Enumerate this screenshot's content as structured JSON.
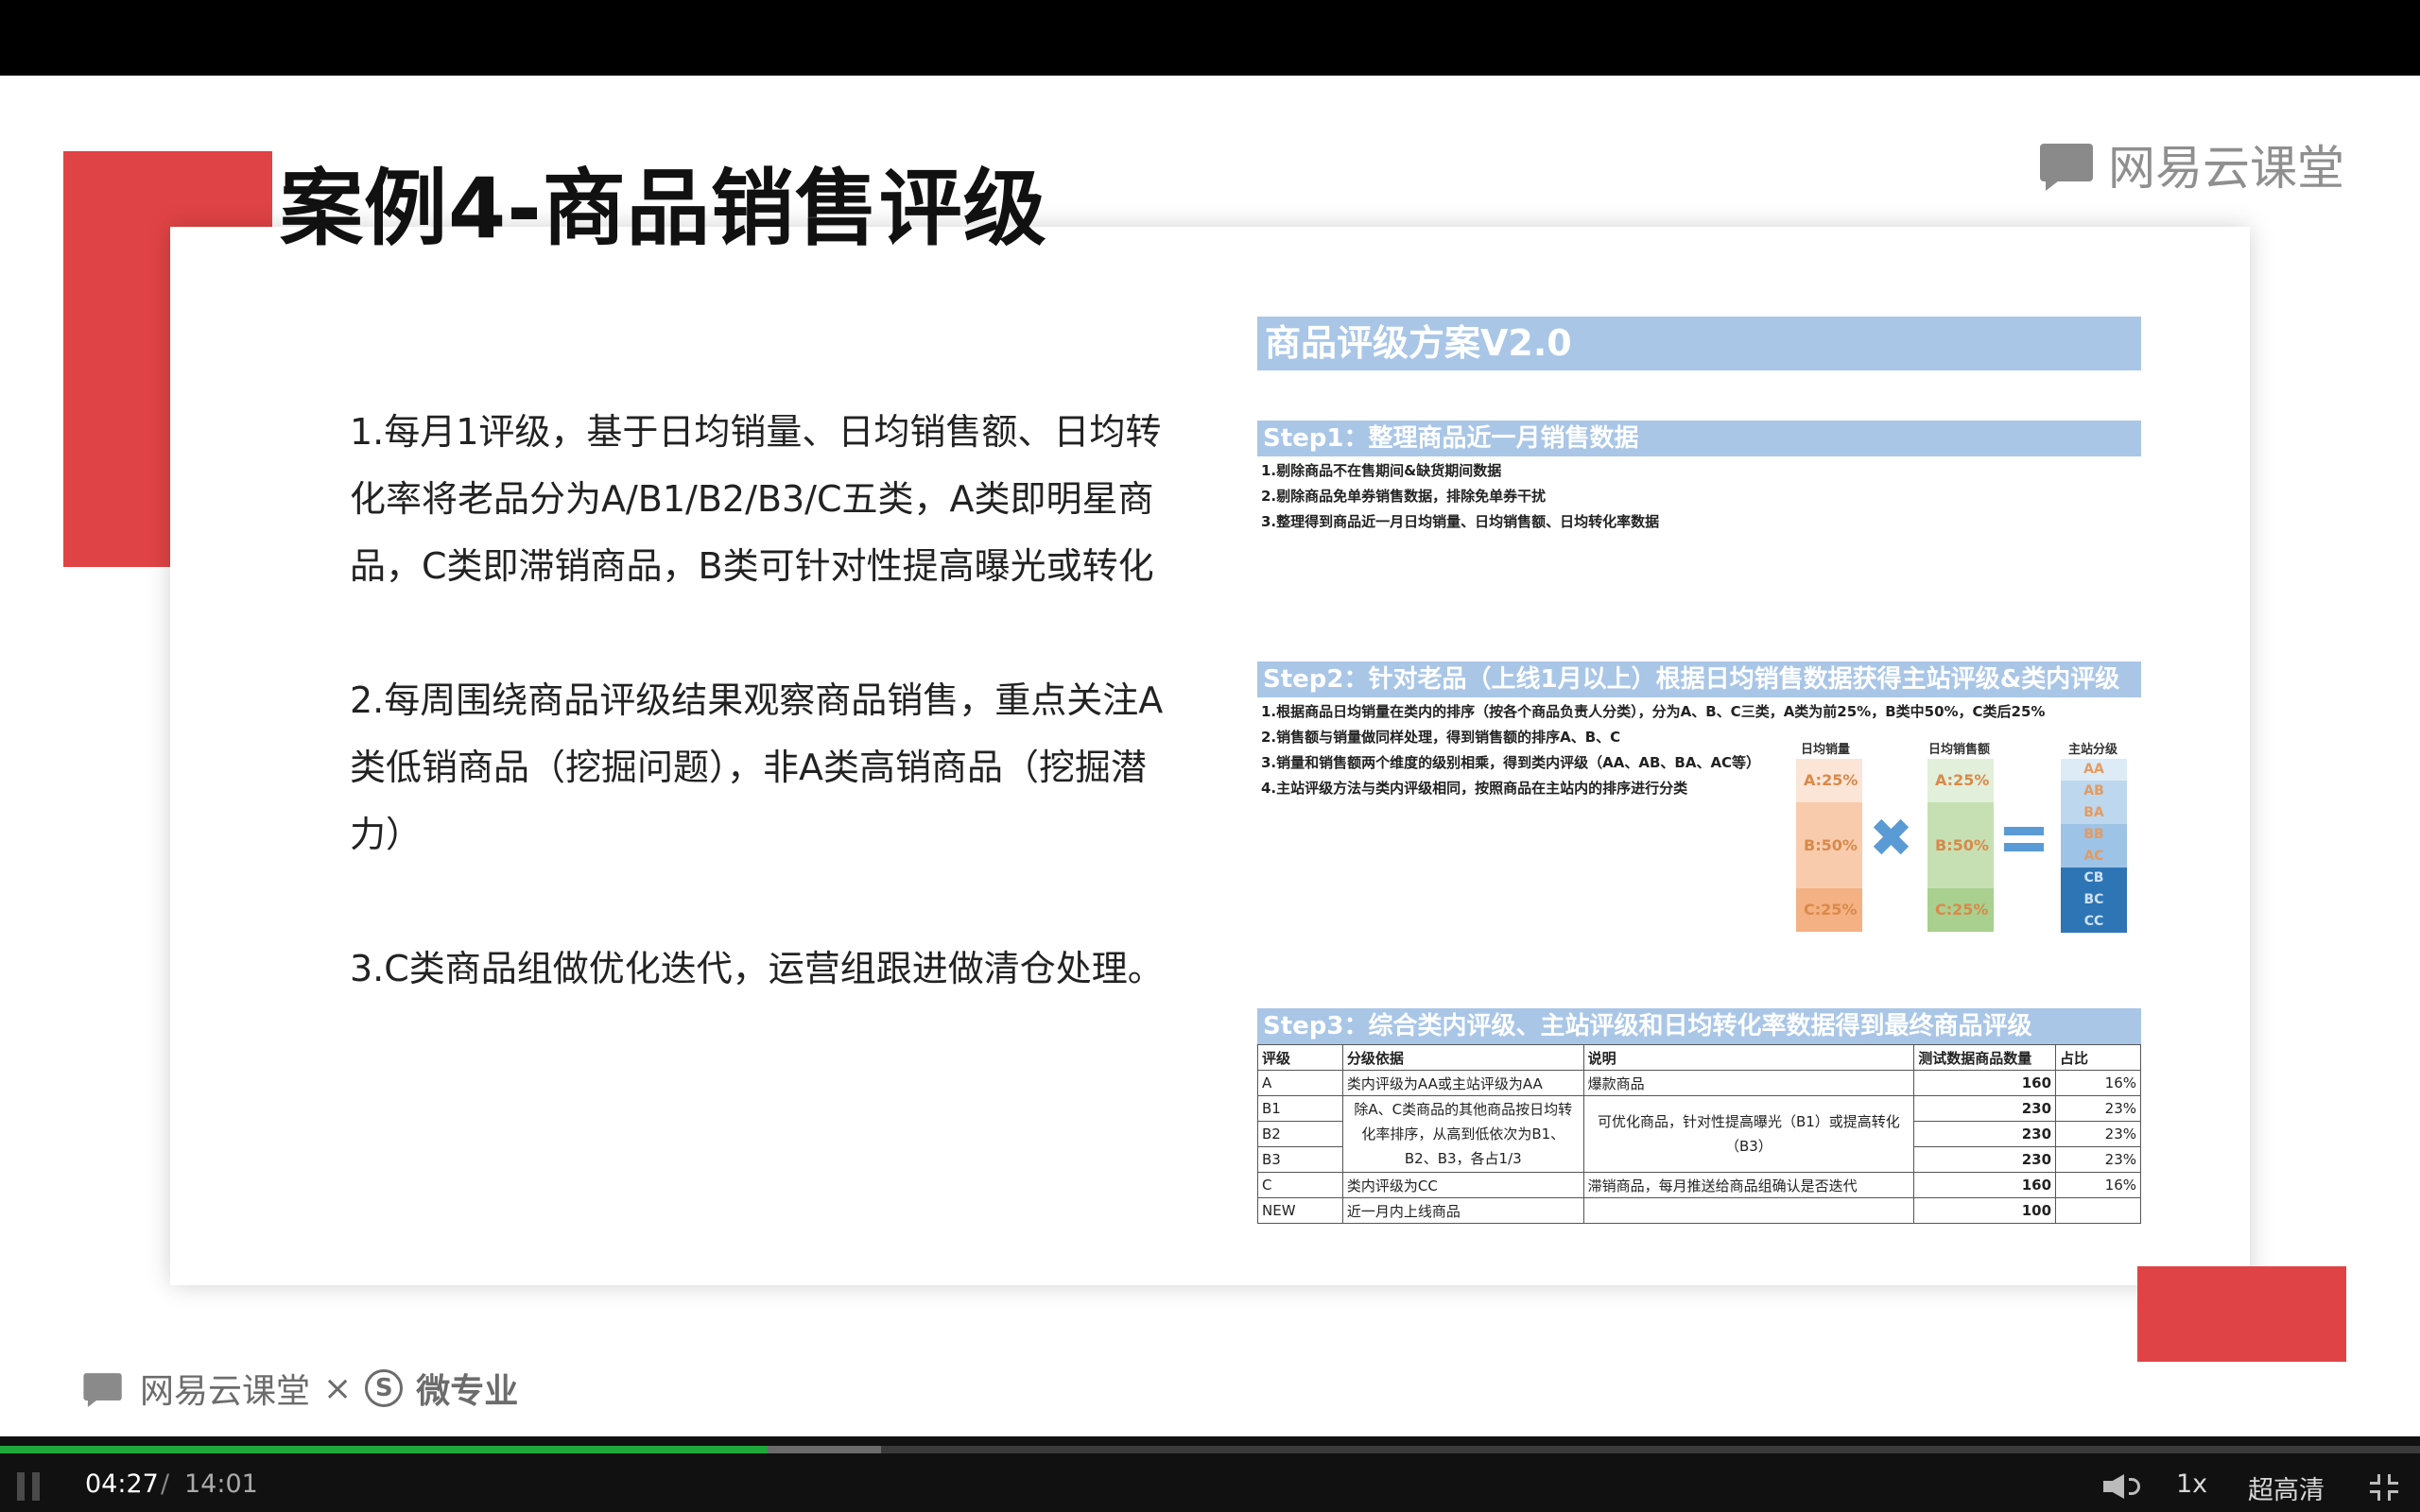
{
  "slide": {
    "title": "案例4-商品销售评级",
    "brand_top": "网易云课堂",
    "paragraphs": [
      "1.每月1评级，基于日均销量、日均销售额、日均转化率将老品分为A/B1/B2/B3/C五类，A类即明星商品，C类即滞销商品，B类可针对性提高曝光或转化",
      "2.每周围绕商品评级结果观察商品销售，重点关注A类低销商品（挖掘问题），非A类高销商品（挖掘潜力）",
      "3.C类商品组做优化迭代，运营组跟进做清仓处理。"
    ],
    "plan": {
      "title": "商品评级方案V2.0",
      "step1": {
        "head": "Step1：整理商品近一月销售数据",
        "lines": [
          "1.剔除商品不在售期间&缺货期间数据",
          "2.剔除商品免单券销售数据，排除免单券干扰",
          "3.整理得到商品近一月日均销量、日均销售额、日均转化率数据"
        ]
      },
      "step2": {
        "head": "Step2：针对老品（上线1月以上）根据日均销售数据获得主站评级&类内评级",
        "lines": [
          "1.根据商品日均销量在类内的排序（按各个商品负责人分类），分为A、B、C三类，A类为前25%，B类中50%，C类后25%",
          "2.销售额与销量做同样处理，得到销售额的排序A、B、C",
          "3.销量和销售额两个维度的级别相乘，得到类内评级（AA、AB、BA、AC等）",
          "4.主站评级方法与类内评级相同，按照商品在主站内的排序进行分类"
        ],
        "col1_label": "日均销量",
        "col2_label": "日均销售额",
        "col3_label": "主站分级",
        "segments": [
          "A:25%",
          "B:50%",
          "C:25%"
        ],
        "grades": [
          "AA",
          "AB",
          "BA",
          "BB",
          "AC",
          "CB",
          "BC",
          "CC"
        ]
      },
      "step3": {
        "head": "Step3：综合类内评级、主站评级和日均转化率数据得到最终商品评级",
        "headers": [
          "评级",
          "分级依据",
          "说明",
          "测试数据商品数量",
          "占比"
        ],
        "rows": [
          {
            "grade": "A",
            "basis": "类内评级为AA或主站评级为AA",
            "desc": "爆款商品",
            "count": "160",
            "pct": "16%"
          },
          {
            "grade": "B1",
            "count": "230",
            "pct": "23%"
          },
          {
            "grade": "B2",
            "count": "230",
            "pct": "23%"
          },
          {
            "grade": "B3",
            "count": "230",
            "pct": "23%"
          },
          {
            "grade": "C",
            "basis": "类内评级为CC",
            "desc": "滞销商品，每月推送给商品组确认是否迭代",
            "count": "160",
            "pct": "16%"
          },
          {
            "grade": "NEW",
            "basis": "近一月内上线商品",
            "desc": "",
            "count": "100",
            "pct": ""
          }
        ],
        "b_basis": "除A、C类商品的其他商品按日均转化率排序，从高到低依次为B1、B2、B3，各占1/3",
        "b_desc": "可优化商品，针对性提高曝光（B1）或提高转化（B3）"
      }
    },
    "brand_bottom": {
      "left": "网易云课堂",
      "times": "×",
      "s_mark": "S",
      "right": "微专业"
    }
  },
  "player": {
    "current_time": "04:27",
    "separator": "/",
    "duration": "14:01",
    "progress": 0.317,
    "buffered": 0.364,
    "speed": "1x",
    "quality": "超高清",
    "accent": "#1fa93a"
  },
  "colors": {
    "brand_red": "#e04345",
    "header_blue": "#a9c6e7"
  }
}
